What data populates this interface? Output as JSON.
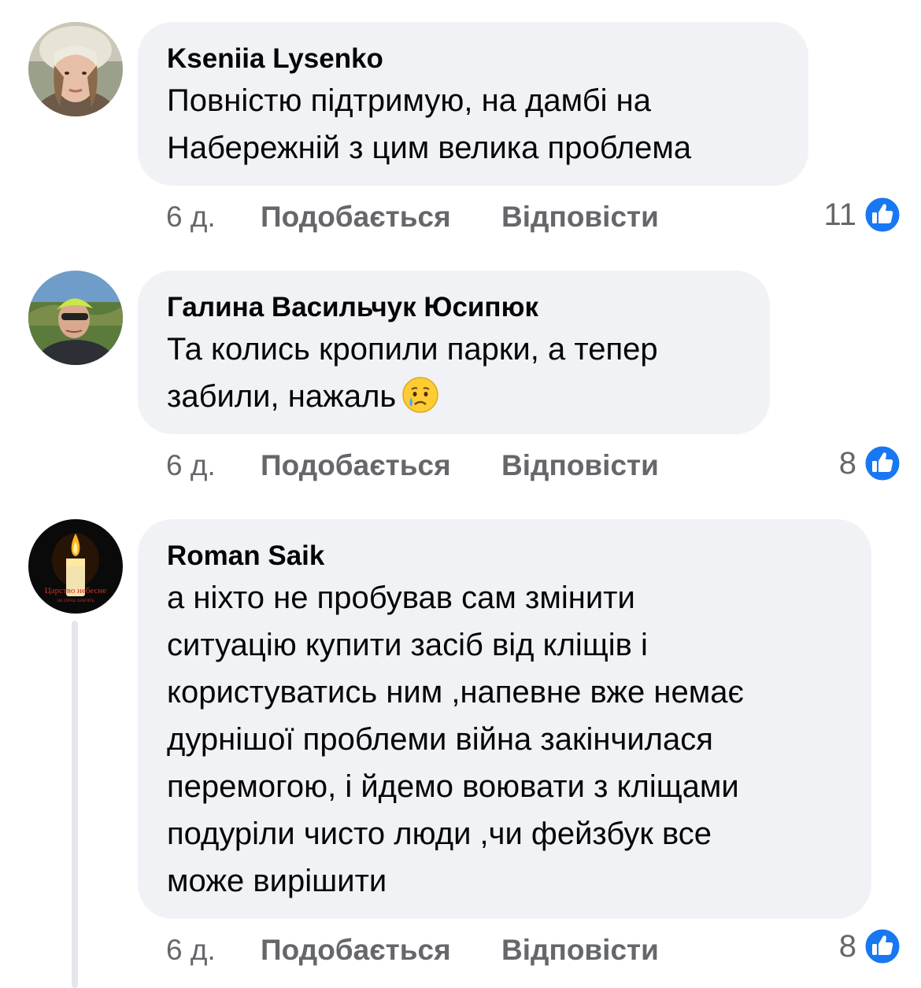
{
  "comments": [
    {
      "author": "Kseniia Lysenko",
      "lines": [
        "Повністю підтримую, на дамбі на",
        "Набережній з цим велика проблема"
      ],
      "avatar_icon": "woman-portrait-avatar",
      "time": "6 д.",
      "like_label": "Подобається",
      "reply_label": "Відповісти",
      "reaction_count": "11",
      "reaction_icon": "like-thumbs-up-icon"
    },
    {
      "author": "Галина Васильчук Юсипюк",
      "lines": [
        "Та колись кропили парки, а тепер",
        "забили, нажаль"
      ],
      "emoji": "crying-face-emoji",
      "avatar_icon": "cyclist-portrait-avatar",
      "time": "6 д.",
      "like_label": "Подобається",
      "reply_label": "Відповісти",
      "reaction_count": "8",
      "reaction_icon": "like-thumbs-up-icon"
    },
    {
      "author": "Roman Saik",
      "lines": [
        "а ніхто не пробував сам змінити",
        "ситуацію купити засіб від кліщів і",
        "користуватись ним ,напевне вже немає",
        "дурнішої проблеми війна закінчилася",
        "перемогою, і йдемо воювати з кліщами",
        "подуріли чисто люди ,чи фейзбук все",
        "може вирішити"
      ],
      "avatar_icon": "memorial-candle-avatar",
      "avatar_text": [
        "Царство небесне",
        "на свіча пам'ять"
      ],
      "time": "6 д.",
      "like_label": "Подобається",
      "reply_label": "Відповісти",
      "reaction_count": "8",
      "reaction_icon": "like-thumbs-up-icon"
    }
  ],
  "colors": {
    "bubble": "#f0f2f5",
    "meta_text": "#65676b",
    "like_blue": "#1877f2",
    "thread_line": "#e4e6eb"
  }
}
